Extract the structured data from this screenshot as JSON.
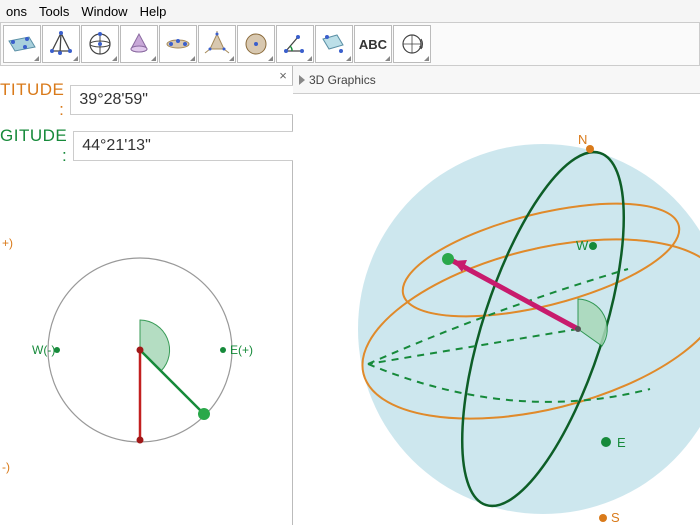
{
  "menu": {
    "items": [
      "ons",
      "Tools",
      "Window",
      "Help"
    ]
  },
  "panel3d_title": "3D Graphics",
  "latitude": {
    "label": "TITUDE :",
    "value": "39°28'59\""
  },
  "longitude": {
    "label": "GITUDE :",
    "value": "44°21'13\""
  },
  "compass2d": {
    "nplus": "+)",
    "sminus": "-)",
    "w": "W(-)",
    "e": "E(+)"
  },
  "cardinals3d": {
    "n": "N",
    "s": "S",
    "e": "E",
    "w": "W"
  },
  "toolbar_text": "ABC",
  "colors": {
    "orange": "#e08a2a",
    "green": "#168a3a",
    "darkgreen": "#0d5e27",
    "red": "#c22020",
    "magenta": "#c81b6d",
    "sphere": "#bcdfe8"
  }
}
